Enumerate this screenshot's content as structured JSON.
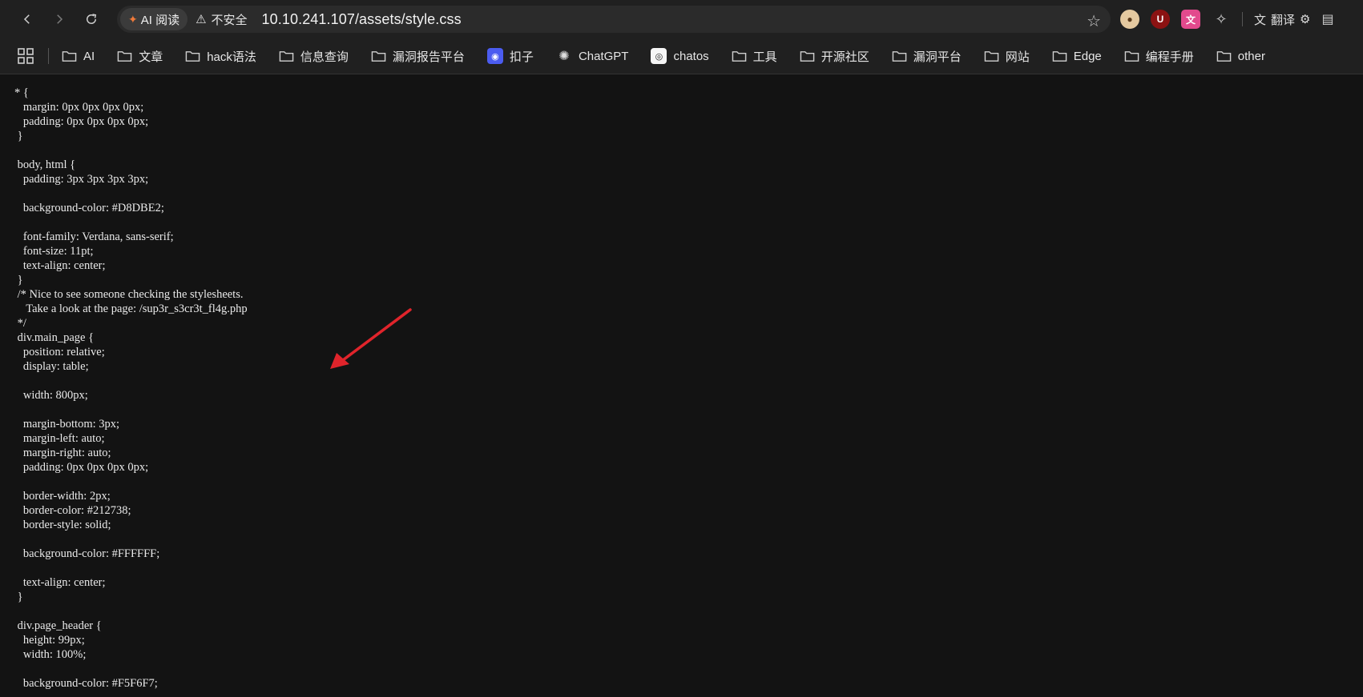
{
  "browser": {
    "ai_chip_label": "AI 阅读",
    "security_label": "不安全",
    "url": "10.10.241.107/assets/style.css",
    "translate_label": "翻译"
  },
  "bookmarks": [
    {
      "label": "AI",
      "icon": "folder-icon"
    },
    {
      "label": "文章",
      "icon": "folder-icon"
    },
    {
      "label": "hack语法",
      "icon": "folder-icon"
    },
    {
      "label": "信息查询",
      "icon": "folder-icon"
    },
    {
      "label": "漏洞报告平台",
      "icon": "folder-icon"
    },
    {
      "label": "扣子",
      "icon": "kouzi-icon"
    },
    {
      "label": "ChatGPT",
      "icon": "chatgpt-icon"
    },
    {
      "label": "chatos",
      "icon": "chatos-icon"
    },
    {
      "label": "工具",
      "icon": "folder-icon"
    },
    {
      "label": "开源社区",
      "icon": "folder-icon"
    },
    {
      "label": "漏洞平台",
      "icon": "folder-icon"
    },
    {
      "label": "网站",
      "icon": "folder-icon"
    },
    {
      "label": "Edge",
      "icon": "folder-icon"
    },
    {
      "label": "编程手册",
      "icon": "folder-icon"
    },
    {
      "label": "other",
      "icon": "folder-icon"
    }
  ],
  "css_source": "* {\n   margin: 0px 0px 0px 0px;\n   padding: 0px 0px 0px 0px;\n }\n\n body, html {\n   padding: 3px 3px 3px 3px;\n\n   background-color: #D8DBE2;\n\n   font-family: Verdana, sans-serif;\n   font-size: 11pt;\n   text-align: center;\n }\n /* Nice to see someone checking the stylesheets.\n    Take a look at the page: /sup3r_s3cr3t_fl4g.php\n */\n div.main_page {\n   position: relative;\n   display: table;\n\n   width: 800px;\n\n   margin-bottom: 3px;\n   margin-left: auto;\n   margin-right: auto;\n   padding: 0px 0px 0px 0px;\n\n   border-width: 2px;\n   border-color: #212738;\n   border-style: solid;\n\n   background-color: #FFFFFF;\n\n   text-align: center;\n }\n\n div.page_header {\n   height: 99px;\n   width: 100%;\n\n   background-color: #F5F6F7;",
  "colors": {
    "annotation_arrow": "#e0242b"
  }
}
